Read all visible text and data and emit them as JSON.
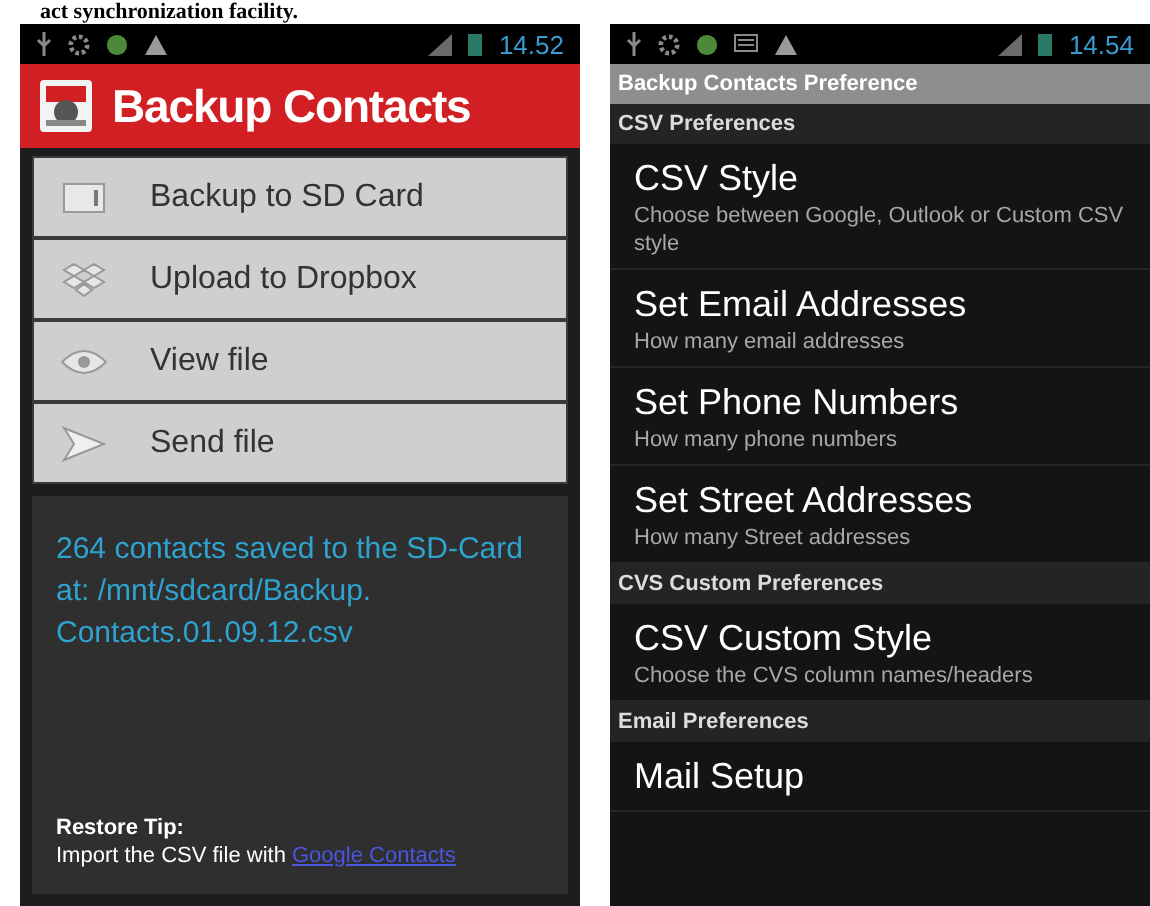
{
  "caption": "act synchronization facility.",
  "screens": [
    {
      "kind": "backup",
      "time": "14.52",
      "title": "Backup Contacts",
      "menu": [
        {
          "label": "Backup to SD Card"
        },
        {
          "label": "Upload to Dropbox"
        },
        {
          "label": "View file"
        },
        {
          "label": "Send file"
        }
      ],
      "message": "264 contacts saved to the SD-Card at: /mnt/sdcard/Backup. Contacts.01.09.12.csv",
      "tip_title": "Restore Tip:",
      "tip_text": "Import the CSV file with",
      "tip_link": "Google Contacts"
    },
    {
      "kind": "preferences",
      "time": "14.54",
      "title": "Backup Contacts Preference",
      "sections": [
        {
          "header": "CSV Preferences",
          "items": [
            {
              "title": "CSV Style",
              "summary": "Choose between Google, Outlook or Custom CSV style"
            },
            {
              "title": "Set Email Addresses",
              "summary": "How many email addresses"
            },
            {
              "title": "Set Phone Numbers",
              "summary": "How many phone numbers"
            },
            {
              "title": "Set Street Addresses",
              "summary": "How many Street addresses"
            }
          ]
        },
        {
          "header": "CVS Custom Preferences",
          "items": [
            {
              "title": "CSV Custom Style",
              "summary": "Choose the CVS column names/headers"
            }
          ]
        },
        {
          "header": "Email Preferences",
          "items": [
            {
              "title": "Mail Setup"
            }
          ]
        }
      ]
    }
  ]
}
